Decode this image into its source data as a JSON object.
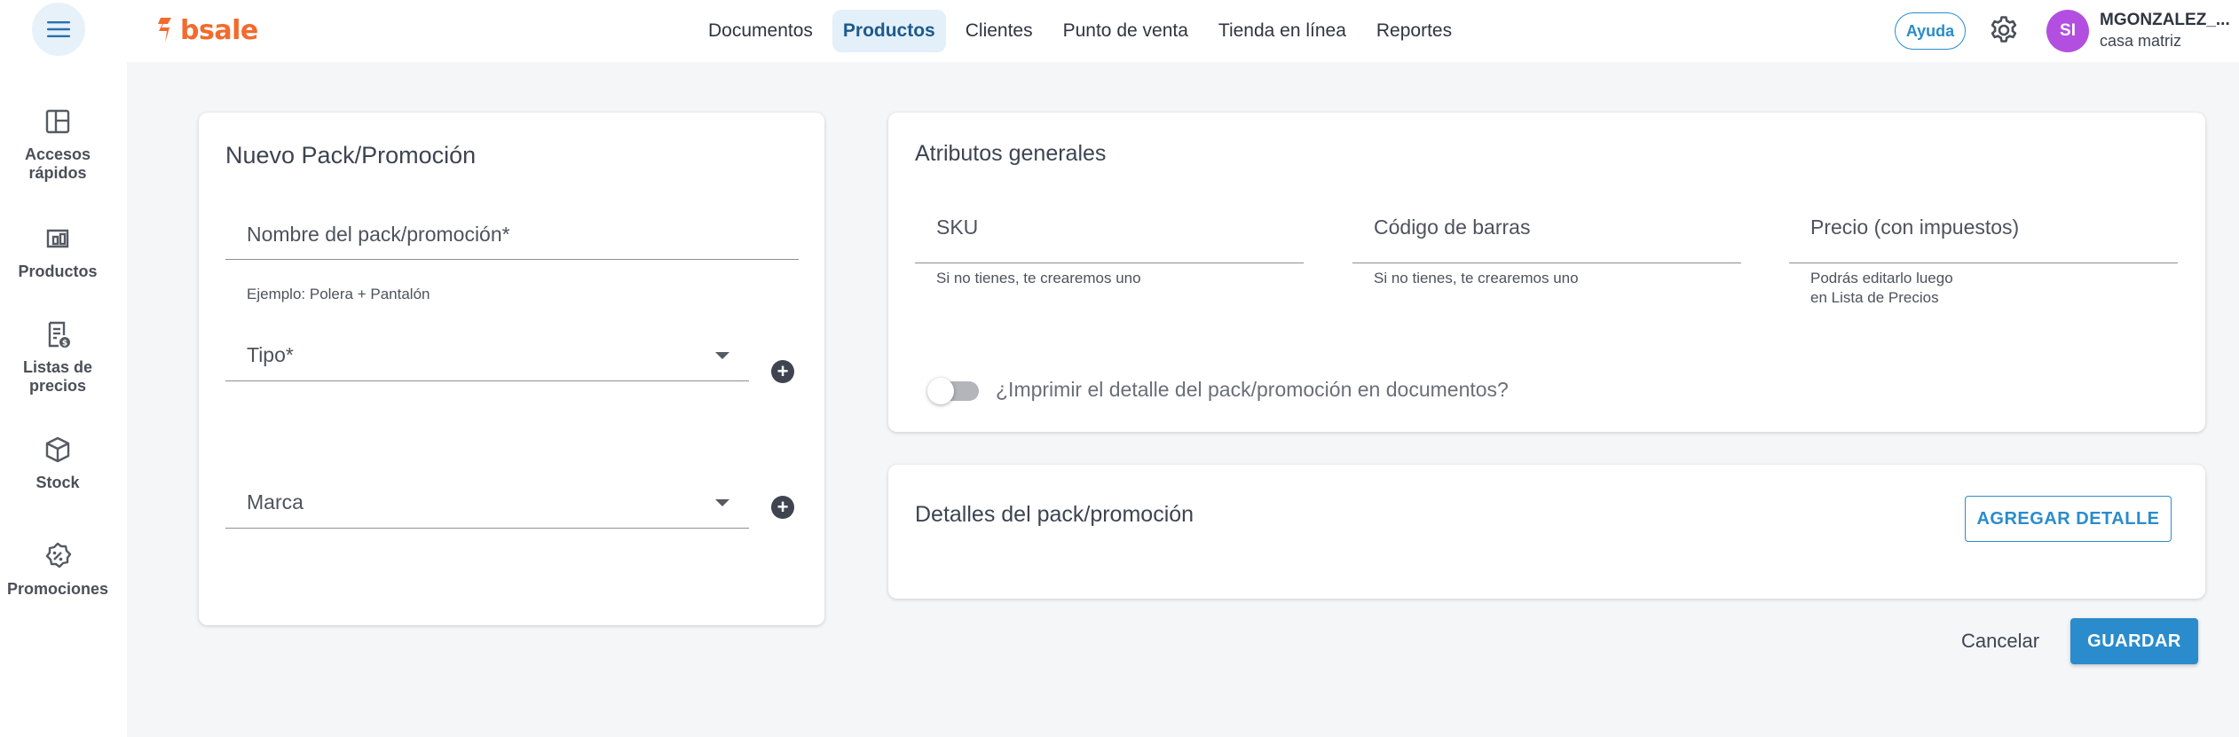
{
  "header": {
    "logo_text": "bsale",
    "brand_color": "#f26b2c",
    "accent_color": "#2a8ccc",
    "nav": [
      {
        "label": "Documentos",
        "active": false
      },
      {
        "label": "Productos",
        "active": true
      },
      {
        "label": "Clientes",
        "active": false
      },
      {
        "label": "Punto de venta",
        "active": false
      },
      {
        "label": "Tienda en línea",
        "active": false
      },
      {
        "label": "Reportes",
        "active": false
      }
    ],
    "help_label": "Ayuda",
    "avatar_initials": "SI",
    "user_name": "MGONZALEZ_...",
    "user_branch": "casa matriz"
  },
  "sidebar": {
    "items": [
      {
        "label_line1": "Accesos",
        "label_line2": "rápidos",
        "icon": "dashboard-icon"
      },
      {
        "label_line1": "Productos",
        "label_line2": "",
        "icon": "products-icon"
      },
      {
        "label_line1": "Listas de",
        "label_line2": "precios",
        "icon": "price-list-icon"
      },
      {
        "label_line1": "Stock",
        "label_line2": "",
        "icon": "box-icon"
      },
      {
        "label_line1": "Promociones",
        "label_line2": "",
        "icon": "discount-icon"
      }
    ]
  },
  "new_pack": {
    "title": "Nuevo Pack/Promoción",
    "name_label": "Nombre del pack/promoción*",
    "name_hint": "Ejemplo: Polera + Pantalón",
    "type_label": "Tipo*",
    "brand_label": "Marca"
  },
  "general_attributes": {
    "title": "Atributos generales",
    "sku_label": "SKU",
    "sku_hint": "Si no tienes, te crearemos uno",
    "barcode_label": "Código de barras",
    "barcode_hint": "Si no tienes, te crearemos uno",
    "price_label": "Precio (con impuestos)",
    "price_hint_line1": "Podrás editarlo luego",
    "price_hint_line2": "en Lista de Precios",
    "print_detail_label": "¿Imprimir el detalle del pack/promoción en documentos?",
    "print_detail_enabled": false
  },
  "pack_details": {
    "title": "Detalles del pack/promoción",
    "add_detail_label": "AGREGAR DETALLE"
  },
  "actions": {
    "cancel_label": "Cancelar",
    "save_label": "GUARDAR"
  }
}
